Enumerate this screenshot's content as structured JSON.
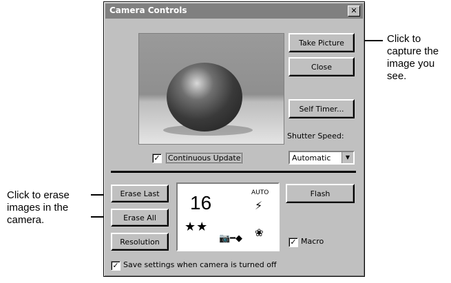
{
  "callouts": {
    "right": "Click to capture the image you see.",
    "left": "Click to erase images in the camera."
  },
  "dialog": {
    "title": "Camera Controls",
    "close_glyph": "✕",
    "take_picture": "Take Picture",
    "close": "Close",
    "self_timer": "Self Timer...",
    "shutter_speed_label": "Shutter Speed:",
    "shutter_speed_value": "Automatic",
    "continuous_update": "Continuous Update",
    "erase_last": "Erase Last",
    "erase_all": "Erase All",
    "resolution": "Resolution",
    "flash": "Flash",
    "macro": "Macro",
    "save_settings": "Save settings when camera is turned off"
  },
  "status_panel": {
    "count": "16",
    "flash_mode": "AUTO",
    "flash_glyph": "⚡",
    "quality_stars": "★★",
    "connection_glyph": "📷━◆",
    "macro_glyph": "❀"
  },
  "checks": {
    "continuous_update": true,
    "macro": true,
    "save_settings": true
  }
}
